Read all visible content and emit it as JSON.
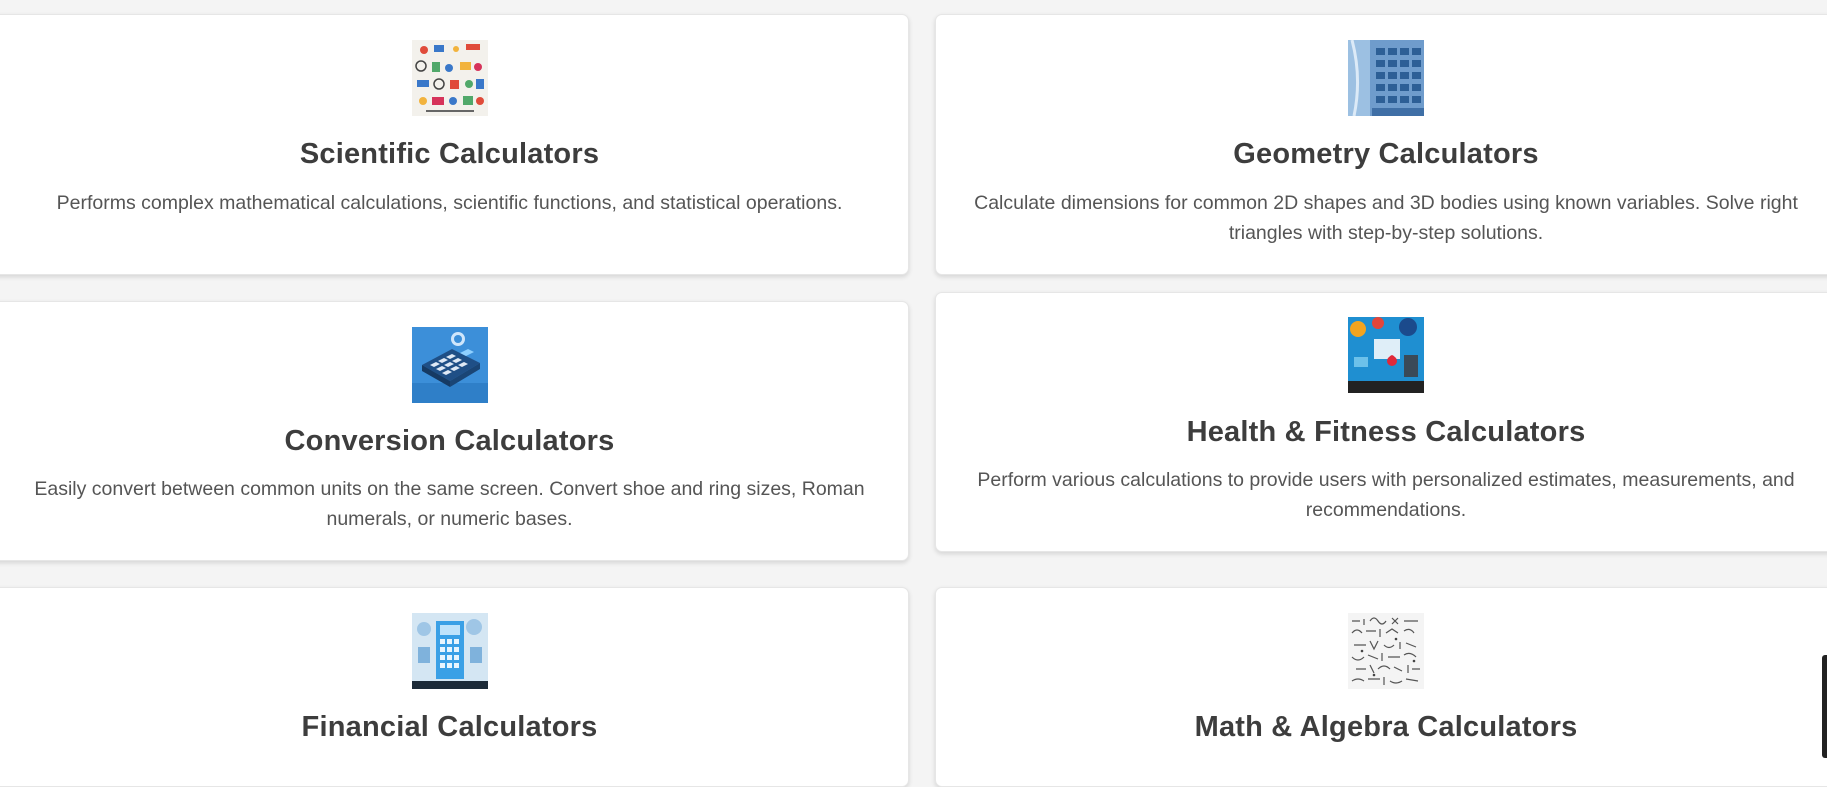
{
  "cards": [
    {
      "title": "Scientific Calculators",
      "description": "Performs complex mathematical calculations, scientific functions, and statistical operations.",
      "image": "science-collage-image"
    },
    {
      "title": "Geometry Calculators",
      "description": "Calculate dimensions for common 2D shapes and 3D bodies using known variables. Solve right triangles with step-by-step solutions.",
      "image": "blue-calculator-keypad-image"
    },
    {
      "title": "Conversion Calculators",
      "description": "Easily convert between common units on the same screen. Convert shoe and ring sizes, Roman numerals, or numeric bases.",
      "image": "isometric-calculator-image"
    },
    {
      "title": "Health & Fitness Calculators",
      "description": "Perform various calculations to provide users with personalized estimates, measurements, and recommendations.",
      "image": "health-items-image"
    },
    {
      "title": "Financial Calculators",
      "description": "",
      "image": "finance-calculator-image"
    },
    {
      "title": "Math & Algebra Calculators",
      "description": "",
      "image": "math-formulas-sketch-image"
    }
  ],
  "colors": {
    "page_background": "#f4f4f4",
    "card_background": "#ffffff",
    "title_text": "#3d3d3d",
    "body_text": "#555555"
  }
}
